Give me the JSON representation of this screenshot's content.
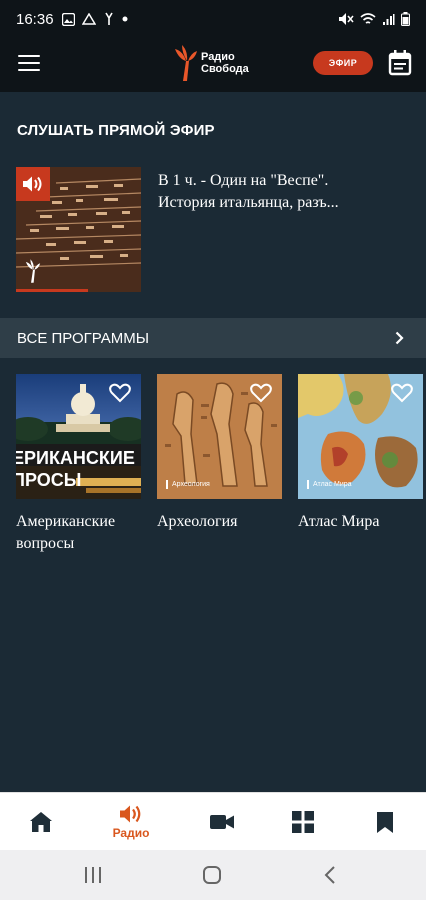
{
  "status_bar": {
    "time": "16:36"
  },
  "header": {
    "logo_line1": "Радио",
    "logo_line2": "Свобода",
    "live_button": "ЭФИР"
  },
  "live": {
    "section_title": "СЛУШАТЬ ПРЯМОЙ ЭФИР",
    "line1": "В 1 ч. - Один на \"Веспе\".",
    "line2": "История итальянца, разъ..."
  },
  "all_programs": {
    "label": "ВСЕ ПРОГРАММЫ"
  },
  "programs": [
    {
      "title": "Американские вопросы",
      "banner_line1": "ЕРИКАНСКИЕ",
      "banner_line2": "ПРОСЫ"
    },
    {
      "title": "Археология",
      "tag": "Археология"
    },
    {
      "title": "Атлас Мира",
      "tag": "Атлас Мира"
    }
  ],
  "bottom_nav": {
    "radio_label": "Радио",
    "active_color": "#d9571e"
  },
  "colors": {
    "accent": "#c7391e",
    "background": "#1b2a35",
    "header": "#0e1418"
  }
}
